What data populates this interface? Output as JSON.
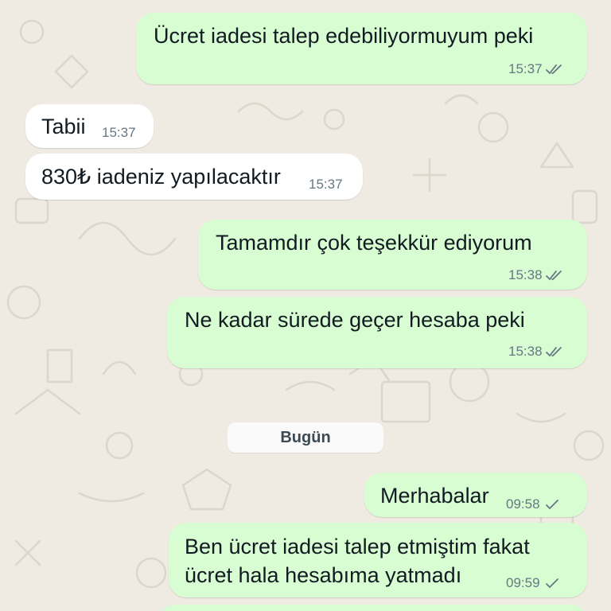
{
  "messages": [
    {
      "text": "Ücret iadesi talep edebiliyormuyum peki",
      "time": "15:37",
      "status": "read"
    },
    {
      "text": "Tabii",
      "time": "15:37"
    },
    {
      "text": "830₺ iadeniz yapılacaktır",
      "time": "15:37"
    },
    {
      "text": "Tamamdır çok teşekkür ediyorum",
      "time": "15:38",
      "status": "read"
    },
    {
      "text": "Ne kadar sürede geçer hesaba peki",
      "time": "15:38",
      "status": "read"
    },
    {
      "text": "Merhabalar",
      "time": "09:58",
      "status": "sent"
    },
    {
      "text_line1": "Ben ücret iadesi talep etmiştim fakat",
      "text_line2": "ücret hala hesabıma yatmadı",
      "time": "09:59",
      "status": "sent"
    }
  ],
  "date_separator": "Bugün",
  "colors": {
    "outgoing_bubble": "#d9fdd3",
    "incoming_bubble": "#ffffff",
    "background": "#efeae2",
    "timestamp": "#667781",
    "tick_read": "#667781"
  }
}
